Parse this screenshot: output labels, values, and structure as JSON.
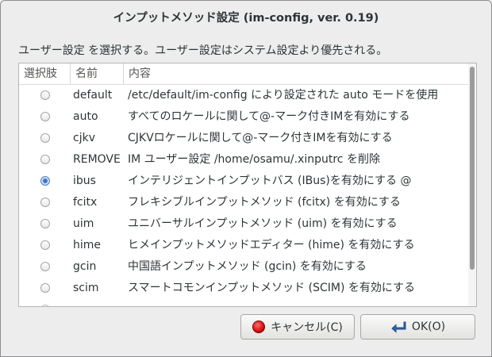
{
  "window": {
    "title": "インプットメソッド設定 (im-config, ver. 0.19)"
  },
  "subtitle": "ユーザー設定 を選択する。ユーザー設定はシステム設定より優先される。",
  "list": {
    "columns": [
      "選択肢",
      "名前",
      "内容"
    ],
    "rows": [
      {
        "name": "default",
        "desc": "/etc/default/im-config により設定された auto モードを使用",
        "selected": false
      },
      {
        "name": "auto",
        "desc": "すべてのロケールに関して@-マーク付きIMを有効にする",
        "selected": false
      },
      {
        "name": "cjkv",
        "desc": "CJKVロケールに関して@-マーク付きIMを有効にする",
        "selected": false
      },
      {
        "name": "REMOVE",
        "desc": "IM ユーザー設定 /home/osamu/.xinputrc を削除",
        "selected": false
      },
      {
        "name": "ibus",
        "desc": "インテリジェントインプットバス (IBus)を有効にする @",
        "selected": true
      },
      {
        "name": "fcitx",
        "desc": "フレキシブルインプットメソッド (fcitx) を有効にする",
        "selected": false
      },
      {
        "name": "uim",
        "desc": "ユニバーサルインプットメソッド (uim) を有効にする",
        "selected": false
      },
      {
        "name": "hime",
        "desc": "ヒメインプットメソッドエディター (hime) を有効にする",
        "selected": false
      },
      {
        "name": "gcin",
        "desc": "中国語インプットメソッド (gcin) を有効にする",
        "selected": false
      },
      {
        "name": "scim",
        "desc": "スマートコモンインプットメソッド (SCIM) を有効にする",
        "selected": false
      },
      {
        "name": "",
        "desc": "",
        "selected": false
      }
    ]
  },
  "buttons": {
    "cancel_label": "キャンセル(C)",
    "ok_label": "OK(O)"
  },
  "icons": {
    "cancel": "stop-icon",
    "ok": "return-arrow-icon"
  },
  "colors": {
    "selected_radio": "#3d77c4",
    "cancel_icon": "#cc0000"
  }
}
